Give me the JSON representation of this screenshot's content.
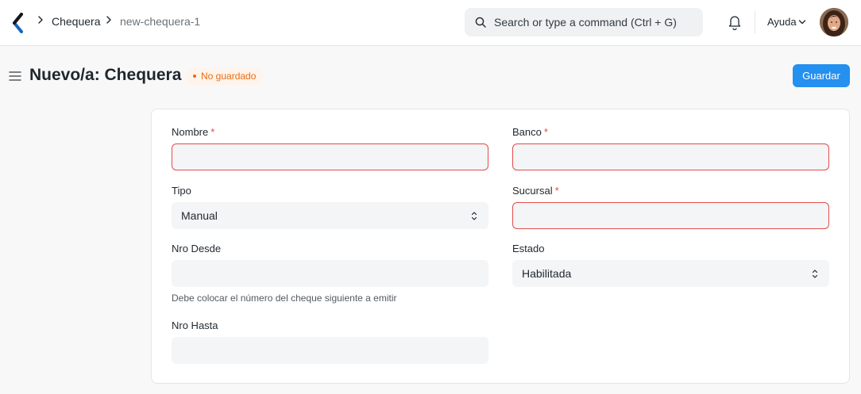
{
  "breadcrumb": {
    "items": [
      "Chequera",
      "new-chequera-1"
    ]
  },
  "navbar": {
    "search_placeholder": "Search or type a command (Ctrl + G)",
    "help_label": "Ayuda"
  },
  "page": {
    "title": "Nuevo/a: Chequera",
    "status_badge": "No guardado",
    "save_label": "Guardar"
  },
  "form": {
    "nombre": {
      "label": "Nombre",
      "required": "*",
      "value": ""
    },
    "banco": {
      "label": "Banco",
      "required": "*",
      "value": ""
    },
    "tipo": {
      "label": "Tipo",
      "value": "Manual"
    },
    "sucursal": {
      "label": "Sucursal",
      "required": "*",
      "value": ""
    },
    "nro_desde": {
      "label": "Nro Desde",
      "value": "",
      "help": "Debe colocar el número del cheque siguiente a emitir"
    },
    "estado": {
      "label": "Estado",
      "value": "Habilitada"
    },
    "nro_hasta": {
      "label": "Nro Hasta",
      "value": ""
    }
  },
  "colors": {
    "primary": "#2490ef",
    "error": "#e24c4c",
    "badge_text": "#e86c13",
    "badge_bg": "#fff4ec"
  },
  "icons": [
    "app-logo-icon",
    "chevron-right-icon",
    "search-icon",
    "bell-icon",
    "chevron-down-icon",
    "hamburger-menu-icon",
    "select-arrows-icon"
  ]
}
